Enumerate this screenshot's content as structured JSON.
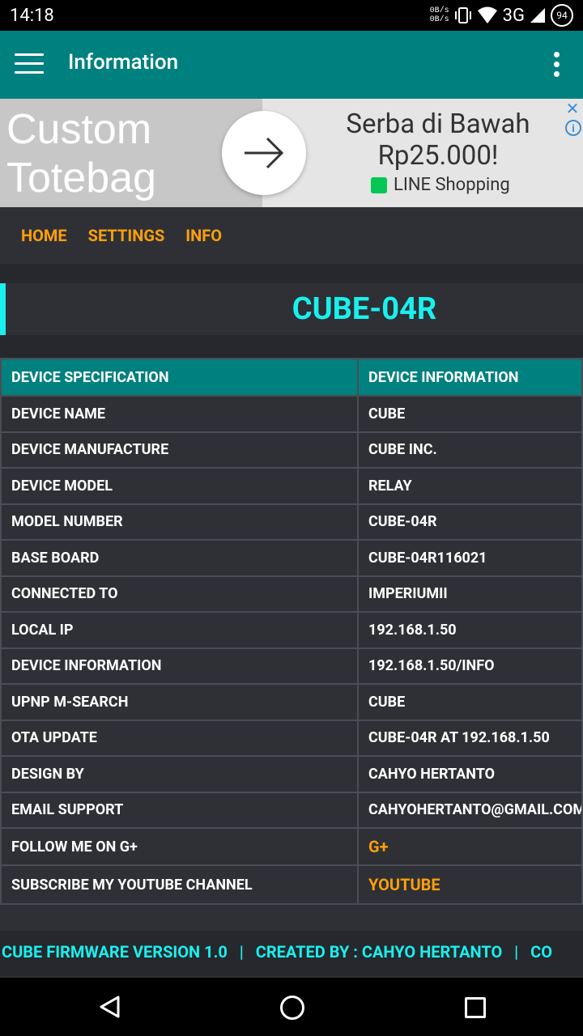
{
  "status": {
    "time": "14:18",
    "net_up": "0B/s",
    "net_down": "0B/s",
    "network": "3G",
    "battery": "94"
  },
  "appbar": {
    "title": "Information"
  },
  "ad": {
    "image_text_line1": "Custom",
    "image_text_line2": "Totebag",
    "headline_line1": "Serba di Bawah",
    "headline_line2": "Rp25.000!",
    "source": "LINE Shopping",
    "close_glyph": "✕",
    "info_glyph": "i"
  },
  "nav": {
    "home": "HOME",
    "settings": "SETTINGS",
    "info": "INFO"
  },
  "device_title": "CUBE-04R",
  "table": {
    "headers": [
      "DEVICE SPECIFICATION",
      "DEVICE INFORMATION"
    ],
    "rows": [
      [
        "DEVICE NAME",
        "CUBE"
      ],
      [
        "DEVICE MANUFACTURE",
        "CUBE INC."
      ],
      [
        "DEVICE MODEL",
        "RELAY"
      ],
      [
        "MODEL NUMBER",
        "CUBE-04R"
      ],
      [
        "BASE BOARD",
        "CUBE-04R116021"
      ],
      [
        "CONNECTED TO",
        "IMPERIUMII"
      ],
      [
        "LOCAL IP",
        "192.168.1.50"
      ],
      [
        "DEVICE INFORMATION",
        "192.168.1.50/INFO"
      ],
      [
        "UPNP M-SEARCH",
        "CUBE"
      ],
      [
        "OTA UPDATE",
        "CUBE-04R AT 192.168.1.50"
      ],
      [
        "DESIGN BY",
        "CAHYO HERTANTO"
      ],
      [
        "EMAIL SUPPORT",
        "CAHYOHERTANTO@GMAIL.COM"
      ],
      [
        "FOLLOW ME ON G+",
        "G+"
      ],
      [
        "SUBSCRIBE MY YOUTUBE CHANNEL",
        "YOUTUBE"
      ]
    ]
  },
  "footer": {
    "marquee": "CUBE FIRMWARE VERSION 1.0   |   CREATED BY : CAHYO HERTANTO   |   CO"
  },
  "colors": {
    "teal": "#00807f",
    "cyan": "#19f0ee",
    "orange": "#ff9f0b",
    "dark": "#2e3035"
  }
}
